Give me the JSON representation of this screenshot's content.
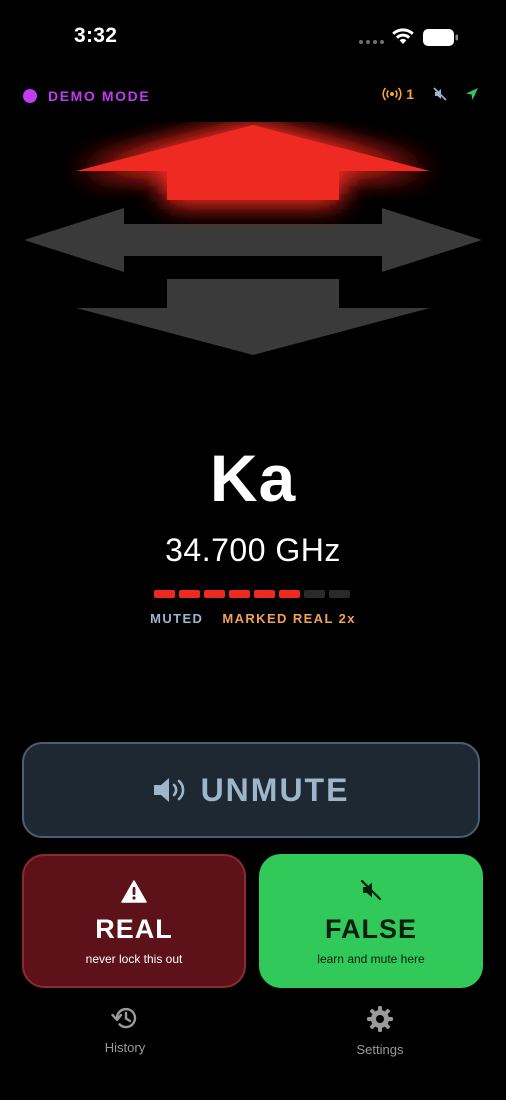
{
  "status_bar": {
    "time": "3:32"
  },
  "header": {
    "mode_label": "DEMO MODE",
    "radar_count": "1",
    "colors": {
      "mode": "#c13cf0",
      "radar": "#f0a63a",
      "location": "#30c95a"
    }
  },
  "direction": {
    "front": "active",
    "side": "inactive",
    "rear": "inactive",
    "colors": {
      "active": "#ee2a20",
      "inactive": "#3a3a3a"
    }
  },
  "alert": {
    "band": "Ka",
    "frequency": "34.700 GHz",
    "strength": {
      "level": 6,
      "max": 8
    },
    "tags": {
      "muted": "MUTED",
      "marked": "MARKED REAL 2x"
    }
  },
  "actions": {
    "unmute": {
      "label": "UNMUTE",
      "icon": "speaker-icon"
    },
    "real": {
      "label": "REAL",
      "sub": "never lock this out",
      "icon": "warning-icon"
    },
    "false": {
      "label": "FALSE",
      "sub": "learn and mute here",
      "icon": "muted-speaker-icon"
    }
  },
  "nav": {
    "history": {
      "label": "History",
      "icon": "history-icon"
    },
    "settings": {
      "label": "Settings",
      "icon": "gear-icon"
    }
  }
}
